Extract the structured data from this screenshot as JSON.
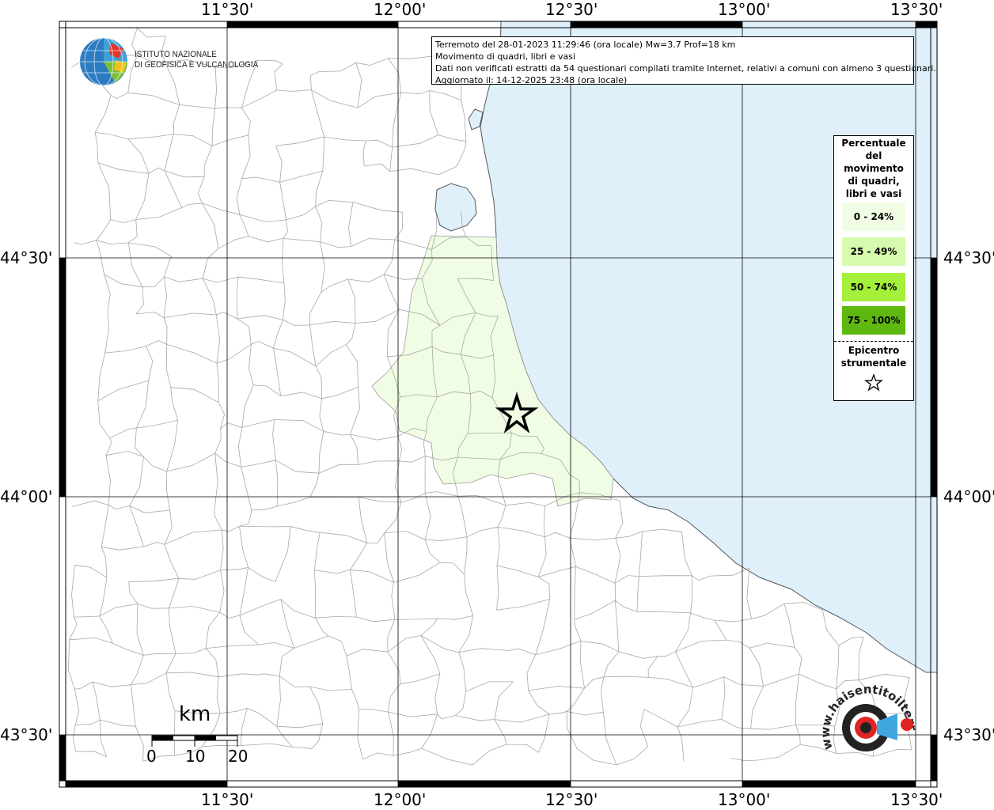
{
  "info": {
    "line1": "Terremoto del 28-01-2023 11:29:46 (ora locale) Mw=3.7 Prof=18 km",
    "line2": "Movimento di quadri, libri e vasi",
    "line3": "Dati non verificati estratti da 54 questionari compilati tramite Internet, relativi a comuni con almeno 3 questionari.",
    "line4": "Aggiornato il: 14-12-2025 23:48 (ora locale)"
  },
  "legend": {
    "title_lines": [
      "Percentuale",
      "del",
      "movimento",
      "di quadri,",
      "libri e vasi"
    ],
    "items": [
      {
        "label": "0 - 24%",
        "color": "#f0fde4"
      },
      {
        "label": "25 - 49%",
        "color": "#d6fbae"
      },
      {
        "label": "50 - 74%",
        "color": "#a4f03a"
      },
      {
        "label": "75 - 100%",
        "color": "#5fb80f"
      }
    ],
    "epicenter_lines": [
      "Epicentro",
      "strumentale"
    ],
    "epicenter_icon": "star-outline-icon"
  },
  "axes": {
    "top_lon": [
      "11°30'",
      "12°00'",
      "12°30'",
      "13°00'",
      "13°30'"
    ],
    "bottom_lon": [
      "11°30'",
      "12°00'",
      "12°30'",
      "13°00'",
      "13°30'"
    ],
    "left_lat": [
      "44°30'",
      "44°00'",
      "43°30'"
    ],
    "right_lat": [
      "44°30'",
      "44°00'",
      "43°30'"
    ]
  },
  "logo": {
    "line1": "ISTITUTO NAZIONALE",
    "line2": "DI GEOFISICA E VULCANOLOGIA"
  },
  "scale_bar": {
    "unit": "km",
    "ticks": [
      "0",
      "10",
      "20"
    ]
  },
  "watermark": {
    "text": "www.haisentitoilterremoto.it",
    "icon": "target-megaphone-icon"
  },
  "colors": {
    "sea": "#dff0fb",
    "land": "#ffffff",
    "affected": "#f0fde4",
    "borders": "#9a9a9a",
    "grid": "#000000"
  }
}
